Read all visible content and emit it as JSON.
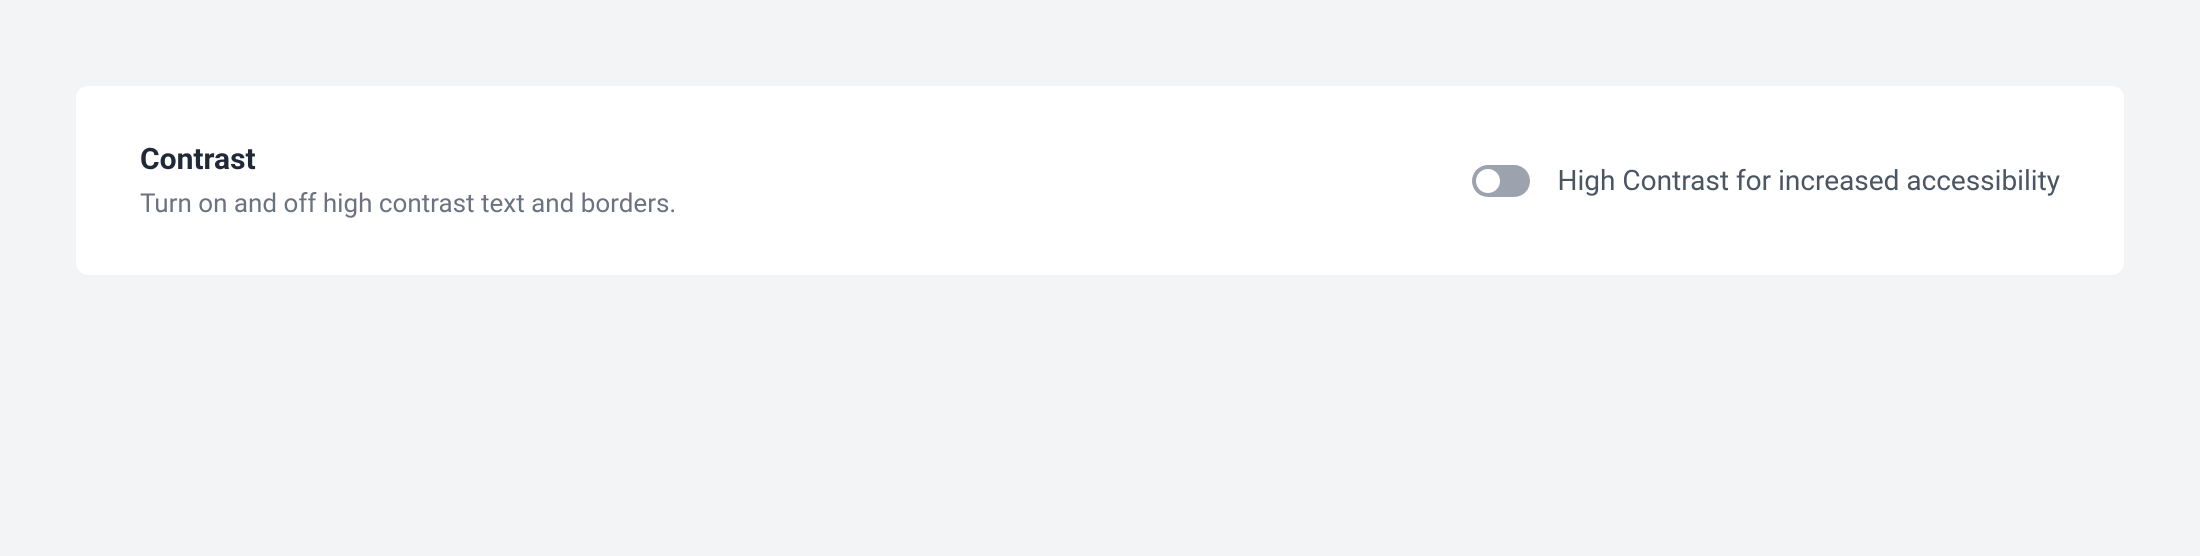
{
  "contrast": {
    "title": "Contrast",
    "description": "Turn on and off high contrast text and borders.",
    "toggle_label": "High Contrast for increased accessibility",
    "enabled": false
  }
}
